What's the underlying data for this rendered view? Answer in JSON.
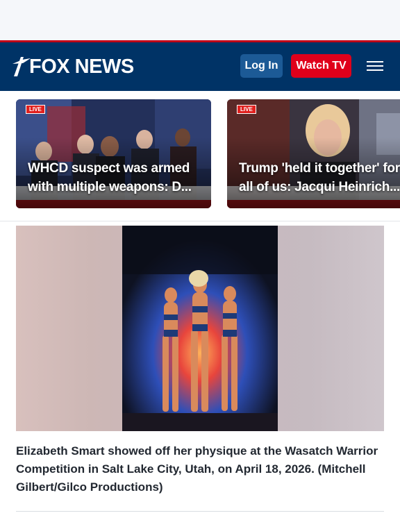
{
  "header": {
    "logo_text": "FOX NEWS",
    "login_label": "Log In",
    "watch_label": "Watch TV",
    "brand_color": "#003366",
    "accent_red": "#e0001b"
  },
  "cards": [
    {
      "headline": "WHCD suspect was armed with multiple weapons: D...",
      "badge": "LIVE"
    },
    {
      "headline": "Trump 'held it together' for all of us: Jacqui Heinrich...",
      "badge": "LIVE"
    }
  ],
  "article": {
    "caption": "Elizabeth Smart showed off her physique at the Wasatch Warrior Competition in Salt Lake City, Utah, on April 18, 2026. (Mitchell Gilbert/Gilco Productions)"
  }
}
